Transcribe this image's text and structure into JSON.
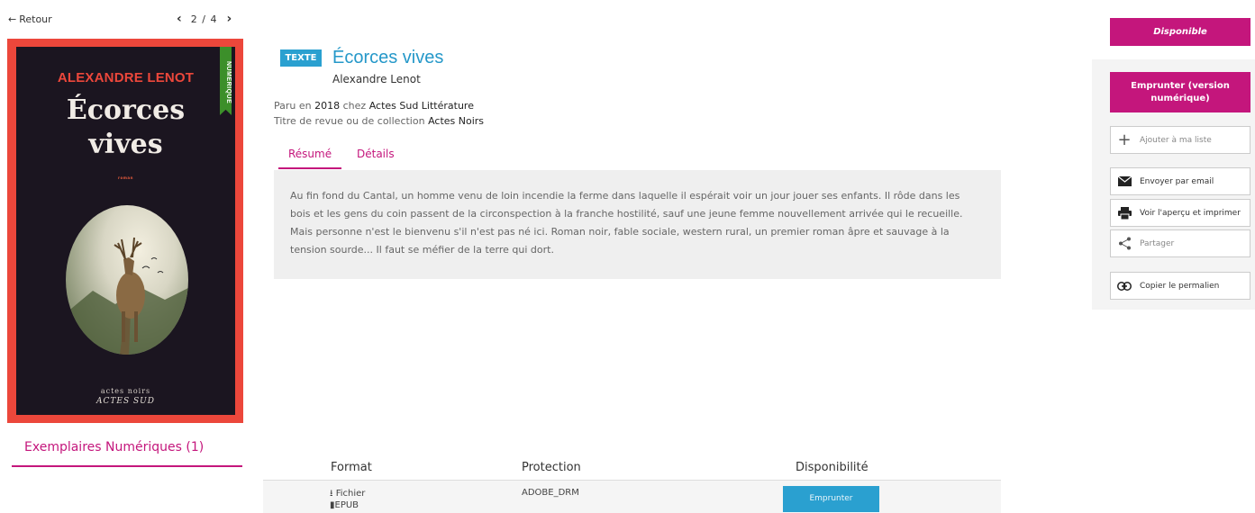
{
  "nav": {
    "back_label": "Retour",
    "pager_text": "2 / 4"
  },
  "cover": {
    "author": "ALEXANDRE LENOT",
    "title_line1": "Écorces",
    "title_line2": "vives",
    "genre": "roman",
    "series": "actes noirs",
    "publisher": "ACTES SUD",
    "ribbon": "NUMÉRIQUE",
    "colors": {
      "frame": "#ec473b",
      "background": "#1b1520",
      "ribbon": "#3c8f2a"
    }
  },
  "record": {
    "type_badge": "TEXTE",
    "title": "Écorces vives",
    "author": "Alexandre Lenot",
    "published_prefix": "Paru en",
    "published_year": "2018",
    "published_mid": "chez",
    "publisher": "Actes Sud Littérature",
    "collection_prefix": "Titre de revue ou de collection",
    "collection": "Actes Noirs"
  },
  "tabs": [
    {
      "label": "Résumé",
      "active": true
    },
    {
      "label": "Détails",
      "active": false
    }
  ],
  "summary": {
    "lines": [
      "Au fin fond du Cantal, un homme venu de loin incendie la ferme dans laquelle il espérait voir un jour jouer ses enfants. Il rôde dans les",
      "bois et les gens du coin passent de la circonspection à la franche hostilité, sauf une jeune femme nouvellement arrivée qui le recueille.",
      "Mais personne n'est le bienvenu s'il n'est pas né ici. Roman noir, fable sociale, western rural, un premier roman âpre et sauvage à la",
      "tension sourde... Il faut se méfier de la terre qui dort."
    ]
  },
  "copies": {
    "section_title": "Exemplaires Numériques (1)",
    "headers": [
      "Format",
      "Protection",
      "Disponibilité"
    ],
    "rows": [
      {
        "format_line1": "Fichier",
        "format_line2": "EPUB",
        "protection": "ADOBE_DRM",
        "action": "Emprunter"
      }
    ]
  },
  "sidebar": {
    "status": "Disponible",
    "borrow_label": "Emprunter (version numérique)",
    "actions": [
      {
        "label": "Ajouter à ma liste",
        "icon": "plus-icon"
      },
      {
        "label": "Envoyer par email",
        "icon": "envelope-icon"
      },
      {
        "label": "Voir l'aperçu et imprimer",
        "icon": "printer-icon"
      },
      {
        "label": "Partager",
        "icon": "share-icon"
      },
      {
        "label": "Copier le permalien",
        "icon": "link-icon"
      }
    ]
  },
  "theme": {
    "accent": "#c4167c",
    "link_blue": "#2598c9",
    "button_blue": "#2aa0d0"
  }
}
